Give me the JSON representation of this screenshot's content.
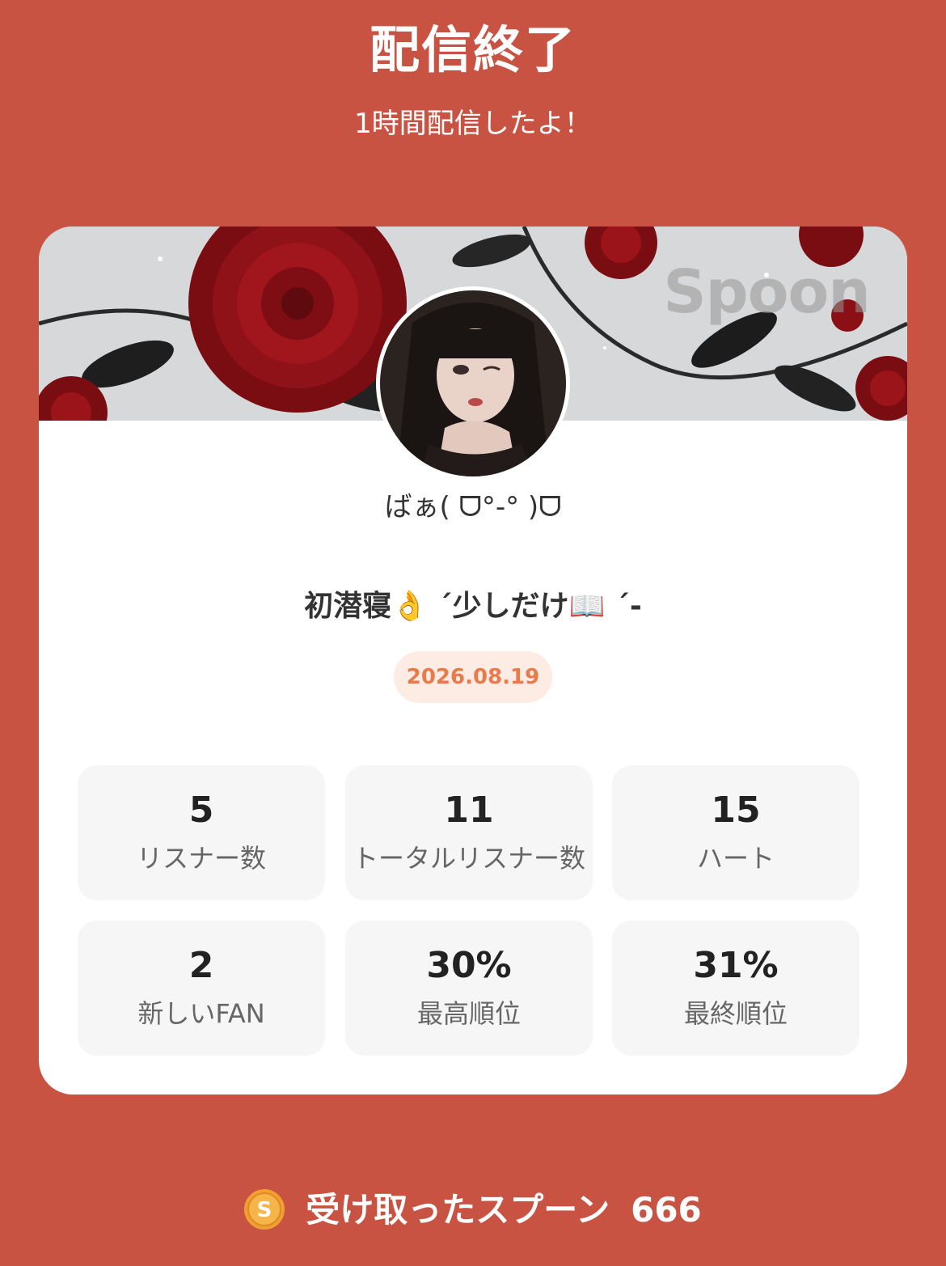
{
  "header": {
    "title": "配信終了",
    "subtitle": "1時間配信したよ！"
  },
  "banner": {
    "watermark": "Spoon"
  },
  "profile": {
    "username": "ばぁ( ᗜ°-° )ᗜ"
  },
  "live": {
    "title": "初潜寝👌 ´少しだけ📖 ´-",
    "date": "2026.08.19"
  },
  "stats": [
    {
      "value": "5",
      "label": "リスナー数"
    },
    {
      "value": "11",
      "label": "トータルリスナー数"
    },
    {
      "value": "15",
      "label": "ハート"
    },
    {
      "value": "2",
      "label": "新しいFAN"
    },
    {
      "value": "30%",
      "label": "最高順位"
    },
    {
      "value": "31%",
      "label": "最終順位"
    }
  ],
  "spoons": {
    "label": "受け取ったスプーン",
    "amount": "666",
    "coin_letter": "S"
  },
  "colors": {
    "background": "#C85343",
    "date_pill_bg": "#FDECE4",
    "date_pill_text": "#E87A4C",
    "coin": "#F0A032"
  }
}
